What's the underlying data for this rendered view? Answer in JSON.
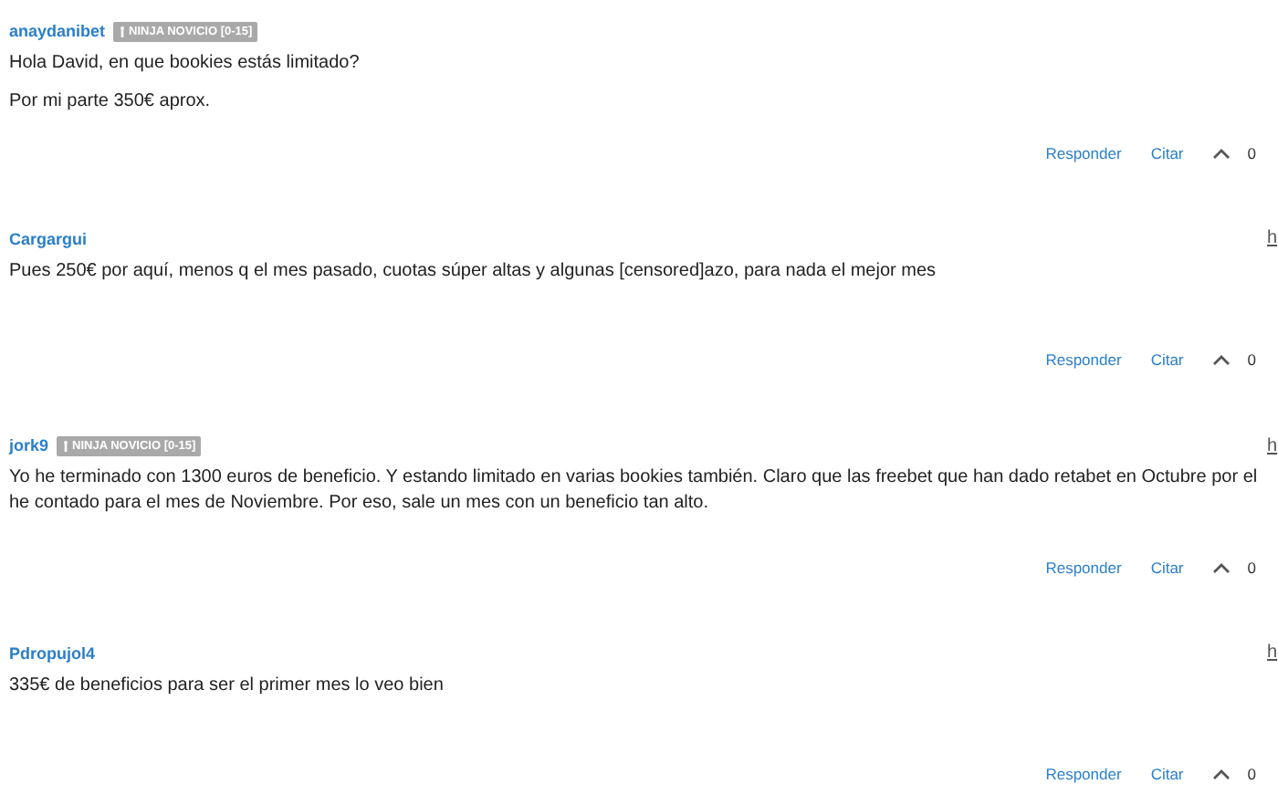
{
  "posts": [
    {
      "author": "anaydanibet",
      "badge": "NINJA NOVICIO [0-15]",
      "paragraphs": [
        [
          "Hola David, en que bookies estás limitado?"
        ],
        [
          "Por mi parte 350€ aprox."
        ]
      ],
      "actions": [
        "Responder",
        "Citar"
      ],
      "votes": "0"
    },
    {
      "author": "Cargargui",
      "time": "h",
      "paragraphs": [
        [
          "Pues 250€ por aquí, menos q el mes pasado, cuotas súper altas y algunas [censored]azo, para nada el mejor mes"
        ]
      ],
      "actions": [
        "Responder",
        "Citar"
      ],
      "votes": "0"
    },
    {
      "author": "jork9",
      "time": "h",
      "badge": "NINJA NOVICIO [0-15]",
      "paragraphs": [
        [
          "Yo he terminado con 1300 euros de beneficio. Y estando limitado en varias bookies también. Claro que las freebet que han dado retabet en Octubre por el",
          "he contado para el mes de Noviembre. Por eso, sale un mes con un beneficio tan alto."
        ]
      ],
      "actions": [
        "Responder",
        "Citar"
      ],
      "votes": "0"
    },
    {
      "author": "Pdropujol4",
      "time": "h",
      "paragraphs": [
        [
          "335€ de beneficios para ser el primer mes lo veo bien"
        ]
      ],
      "actions": [
        "Responder",
        "Citar"
      ],
      "votes": "0"
    }
  ]
}
